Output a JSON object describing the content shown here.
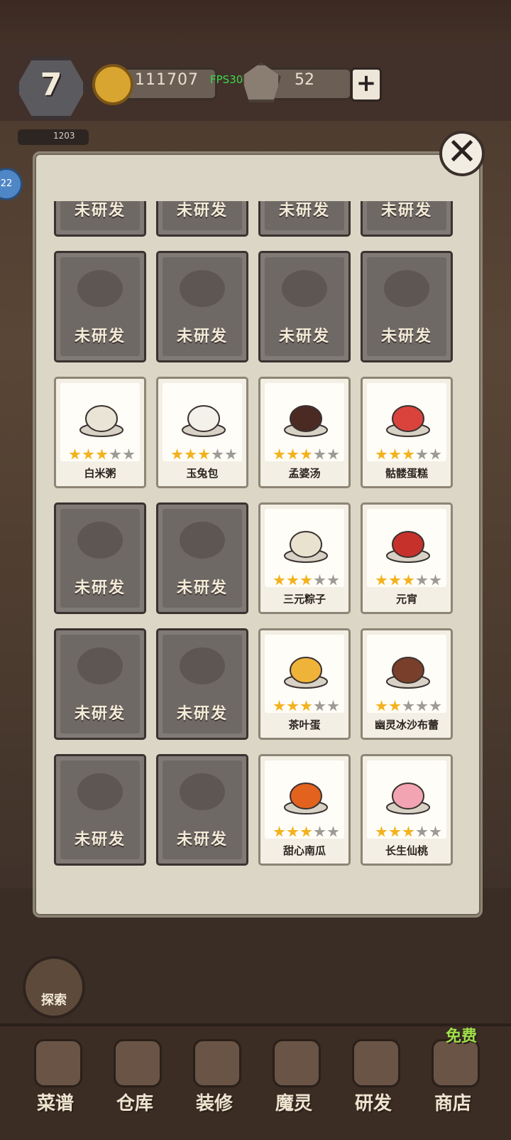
{
  "hud": {
    "level": "7",
    "coins": "111707",
    "fps": "FPS30",
    "gems": "52",
    "plus": "+",
    "side_stat": "1203",
    "side_badge": "22"
  },
  "dialog": {
    "close": "✕",
    "locked_label": "未研发",
    "cards": [
      {
        "state": "locked",
        "icon": "dish-icon"
      },
      {
        "state": "locked",
        "icon": "dish-icon"
      },
      {
        "state": "locked",
        "icon": "dish-icon"
      },
      {
        "state": "locked",
        "icon": "dish-icon"
      },
      {
        "state": "locked",
        "icon": "roast-meat-icon"
      },
      {
        "state": "locked",
        "icon": "fish-dish-icon"
      },
      {
        "state": "locked",
        "icon": "skewer-icon"
      },
      {
        "state": "locked",
        "icon": "greens-dish-icon"
      },
      {
        "state": "unlocked",
        "name": "白米粥",
        "stars": 3,
        "icon": "rice-porridge-icon",
        "color": "#eae4d6"
      },
      {
        "state": "unlocked",
        "name": "玉兔包",
        "stars": 3,
        "icon": "bunny-bun-icon",
        "color": "#f4f0ea"
      },
      {
        "state": "unlocked",
        "name": "孟婆汤",
        "stars": 3,
        "icon": "soup-icon",
        "color": "#4a2a22"
      },
      {
        "state": "unlocked",
        "name": "骷髅蛋糕",
        "stars": 3,
        "icon": "skull-cake-icon",
        "color": "#d9433c"
      },
      {
        "state": "locked",
        "icon": "mooncake-icon"
      },
      {
        "state": "locked",
        "icon": "dumplings-icon"
      },
      {
        "state": "unlocked",
        "name": "三元粽子",
        "stars": 3,
        "icon": "zongzi-icon",
        "color": "#e8e2cf"
      },
      {
        "state": "unlocked",
        "name": "元宵",
        "stars": 3,
        "icon": "tangyuan-icon",
        "color": "#c7312c"
      },
      {
        "state": "locked",
        "icon": "steamed-bun-icon"
      },
      {
        "state": "locked",
        "icon": "hotpot-icon"
      },
      {
        "state": "unlocked",
        "name": "茶叶蛋",
        "stars": 3,
        "icon": "tea-egg-icon",
        "color": "#f0b33a"
      },
      {
        "state": "unlocked",
        "name": "幽灵冰沙布蕾",
        "stars": 2,
        "icon": "ghost-pudding-icon",
        "color": "#7a3f2a"
      },
      {
        "state": "locked",
        "icon": "dessert-bowl-icon"
      },
      {
        "state": "locked",
        "icon": "bento-icon"
      },
      {
        "state": "unlocked",
        "name": "甜心南瓜",
        "stars": 3,
        "icon": "pumpkin-cake-icon",
        "color": "#e2621e"
      },
      {
        "state": "unlocked",
        "name": "长生仙桃",
        "stars": 3,
        "icon": "peach-icon",
        "color": "#f2a4b3"
      }
    ]
  },
  "explore_label": "探索",
  "nav": [
    {
      "label": "菜谱",
      "icon": "recipe-icon"
    },
    {
      "label": "仓库",
      "icon": "warehouse-icon"
    },
    {
      "label": "装修",
      "icon": "hammer-icon"
    },
    {
      "label": "魔灵",
      "icon": "spirit-icon"
    },
    {
      "label": "研发",
      "icon": "cauldron-icon"
    },
    {
      "label": "商店",
      "icon": "shop-bag-icon"
    }
  ],
  "free_badge": "免费",
  "colors": {
    "star_on": "#f3b21d",
    "star_off": "#9e9a94",
    "panel": "#dcd6c6",
    "locked_card": "#807a76"
  }
}
